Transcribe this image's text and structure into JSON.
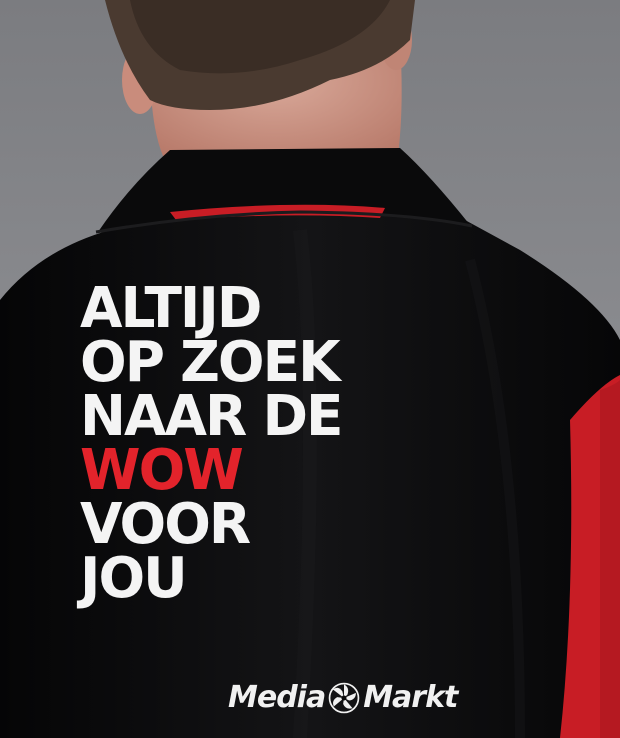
{
  "slogan": {
    "line1": "ALTIJD",
    "line2": "OP ZOEK",
    "line3": "NAAR DE",
    "line4": "WOW",
    "line5": "VOOR",
    "line6": "JOU"
  },
  "logo": {
    "part1": "Media",
    "part2": "Markt",
    "icon": "spiral-logo-icon"
  },
  "colors": {
    "shirt": "#0b0b0c",
    "accent_red": "#e3232b",
    "background": "#8a8b8f",
    "text": "#f4f4f4"
  }
}
